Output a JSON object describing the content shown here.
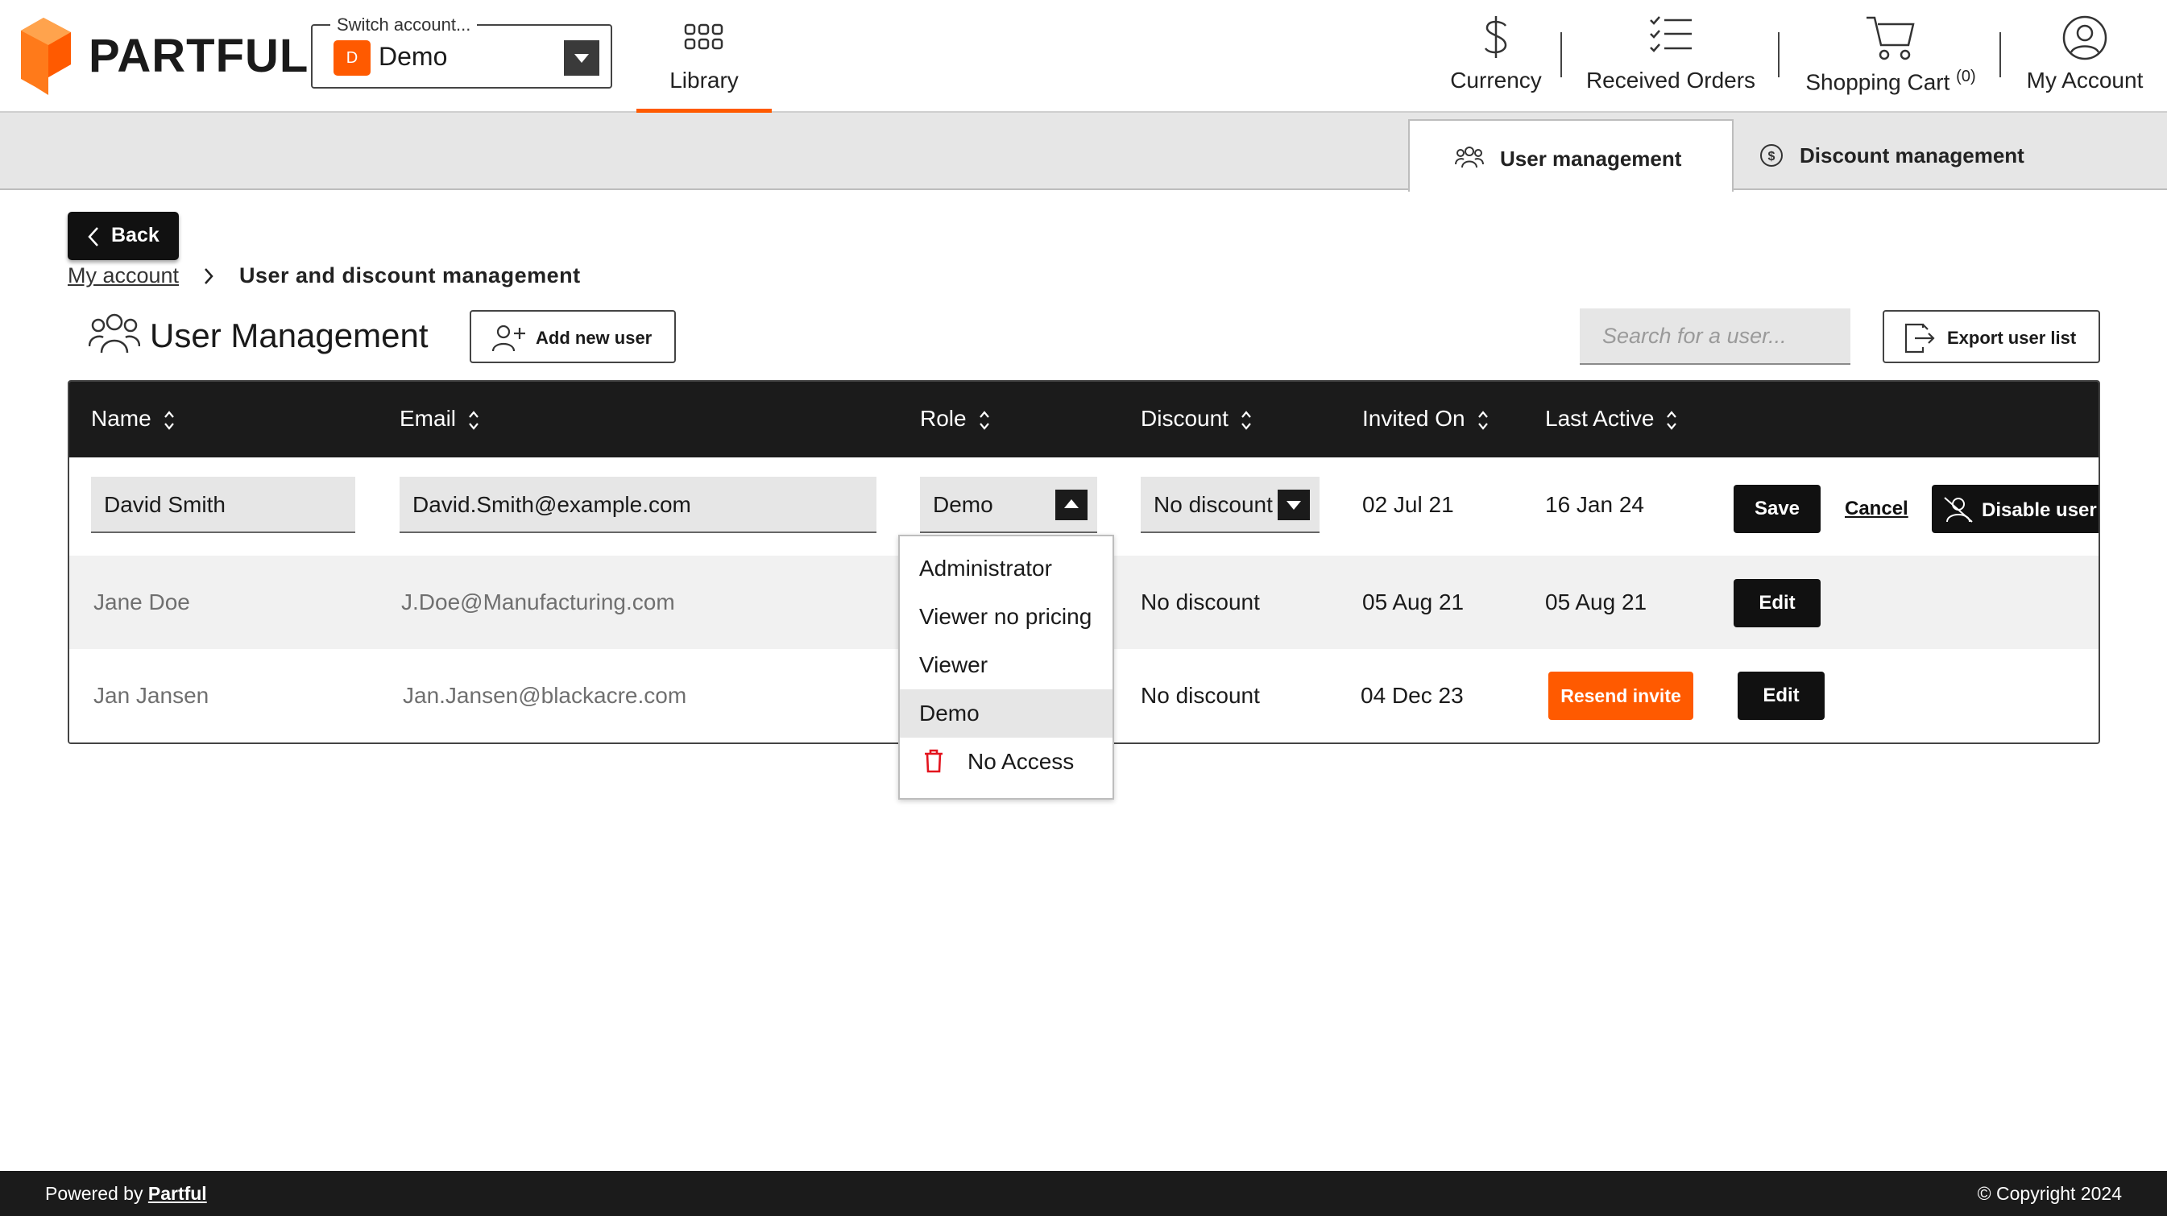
{
  "brand": {
    "name": "PARTFUL",
    "accent": "#ff5a00"
  },
  "header": {
    "account_switch": {
      "legend": "Switch account...",
      "badge": "D",
      "value": "Demo"
    },
    "library_label": "Library",
    "currency_label": "Currency",
    "received_orders_label": "Received Orders",
    "shopping_cart_label": "Shopping Cart",
    "shopping_cart_count": "(0)",
    "my_account_label": "My Account"
  },
  "tabs": [
    {
      "label": "User management",
      "active": true
    },
    {
      "label": "Discount management",
      "active": false
    }
  ],
  "back_label": "Back",
  "breadcrumb": {
    "link": "My account",
    "current": "User and discount management"
  },
  "page": {
    "title": "User Management",
    "add_user_label": "Add new user",
    "search_placeholder": "Search for a user...",
    "export_label": "Export user list"
  },
  "table": {
    "columns": [
      "Name",
      "Email",
      "Role",
      "Discount",
      "Invited On",
      "Last Active"
    ],
    "edit_row": {
      "name": "David Smith",
      "email": "David.Smith@example.com",
      "role": "Demo",
      "discount": "No discount",
      "invited_on": "02 Jul 21",
      "last_active": "16 Jan 24",
      "save_label": "Save",
      "cancel_label": "Cancel",
      "disable_label": "Disable user"
    },
    "rows": [
      {
        "name": "Jane Doe",
        "email": "J.Doe@Manufacturing.com",
        "discount": "No discount",
        "invited_on": "05 Aug 21",
        "last_active": "05 Aug 21",
        "edit_label": "Edit"
      },
      {
        "name": "Jan Jansen",
        "email": "Jan.Jansen@blackacre.com",
        "discount": "No discount",
        "invited_on": "04 Dec 23",
        "resend_label": "Resend invite",
        "edit_label": "Edit"
      }
    ]
  },
  "role_dropdown": {
    "options": [
      "Administrator",
      "Viewer no pricing",
      "Viewer",
      "Demo",
      "No Access"
    ],
    "selected": "Demo"
  },
  "footer": {
    "powered_prefix": "Powered by",
    "powered_link": "Partful",
    "copyright": "© Copyright 2024"
  }
}
